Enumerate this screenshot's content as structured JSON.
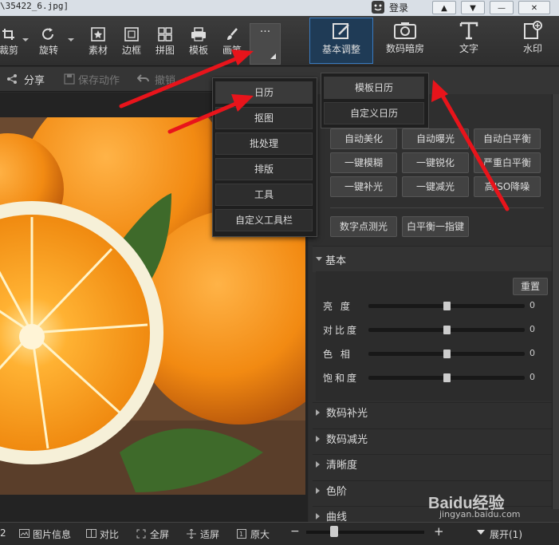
{
  "window": {
    "title": "\\35422_6.jpg]",
    "login": "登录",
    "buttons": [
      "▲",
      "▼",
      "—",
      "✕"
    ]
  },
  "toolbar": {
    "crop": "裁剪",
    "rotate": "旋转",
    "material": "素材",
    "border": "边框",
    "collage": "拼图",
    "template": "模板",
    "brush": "画笔",
    "more": "···"
  },
  "tabs": {
    "basic": "基本调整",
    "darkroom": "数码暗房",
    "text": "文字",
    "watermark": "水印"
  },
  "subbar": {
    "share": "分享",
    "save_action": "保存动作",
    "undo": "撤销"
  },
  "menu": {
    "items": [
      "日历",
      "抠图",
      "批处理",
      "排版",
      "工具",
      "自定义工具栏"
    ]
  },
  "submenu": {
    "items": [
      "模板日历",
      "自定义日历"
    ]
  },
  "panel": {
    "quick_buttons": [
      [
        "自动美化",
        "自动曝光",
        "自动白平衡"
      ],
      [
        "一键模糊",
        "一键锐化",
        "严重白平衡"
      ],
      [
        "一键补光",
        "一键减光",
        "高ISO降噪"
      ]
    ],
    "extra_buttons": [
      "数字点测光",
      "白平衡一指键"
    ],
    "basic_section": "基本",
    "reset": "重置",
    "sliders": [
      {
        "label": "亮  度",
        "value": "0",
        "level": 0.5
      },
      {
        "label": "对比度",
        "value": "0",
        "level": 0.5
      },
      {
        "label": "色  相",
        "value": "0",
        "level": 0.5
      },
      {
        "label": "饱和度",
        "value": "0",
        "level": 0.5
      }
    ],
    "sections": [
      "数码补光",
      "数码减光",
      "清晰度",
      "色阶",
      "曲线"
    ]
  },
  "status": {
    "page_num": "2",
    "image_info": "图片信息",
    "compare": "对比",
    "fullscreen": "全屏",
    "fit": "适屏",
    "original": "原大",
    "expand": "展开(1)"
  },
  "watermark": {
    "brand": "Baidu经验",
    "url": "jingyan.baidu.com"
  }
}
